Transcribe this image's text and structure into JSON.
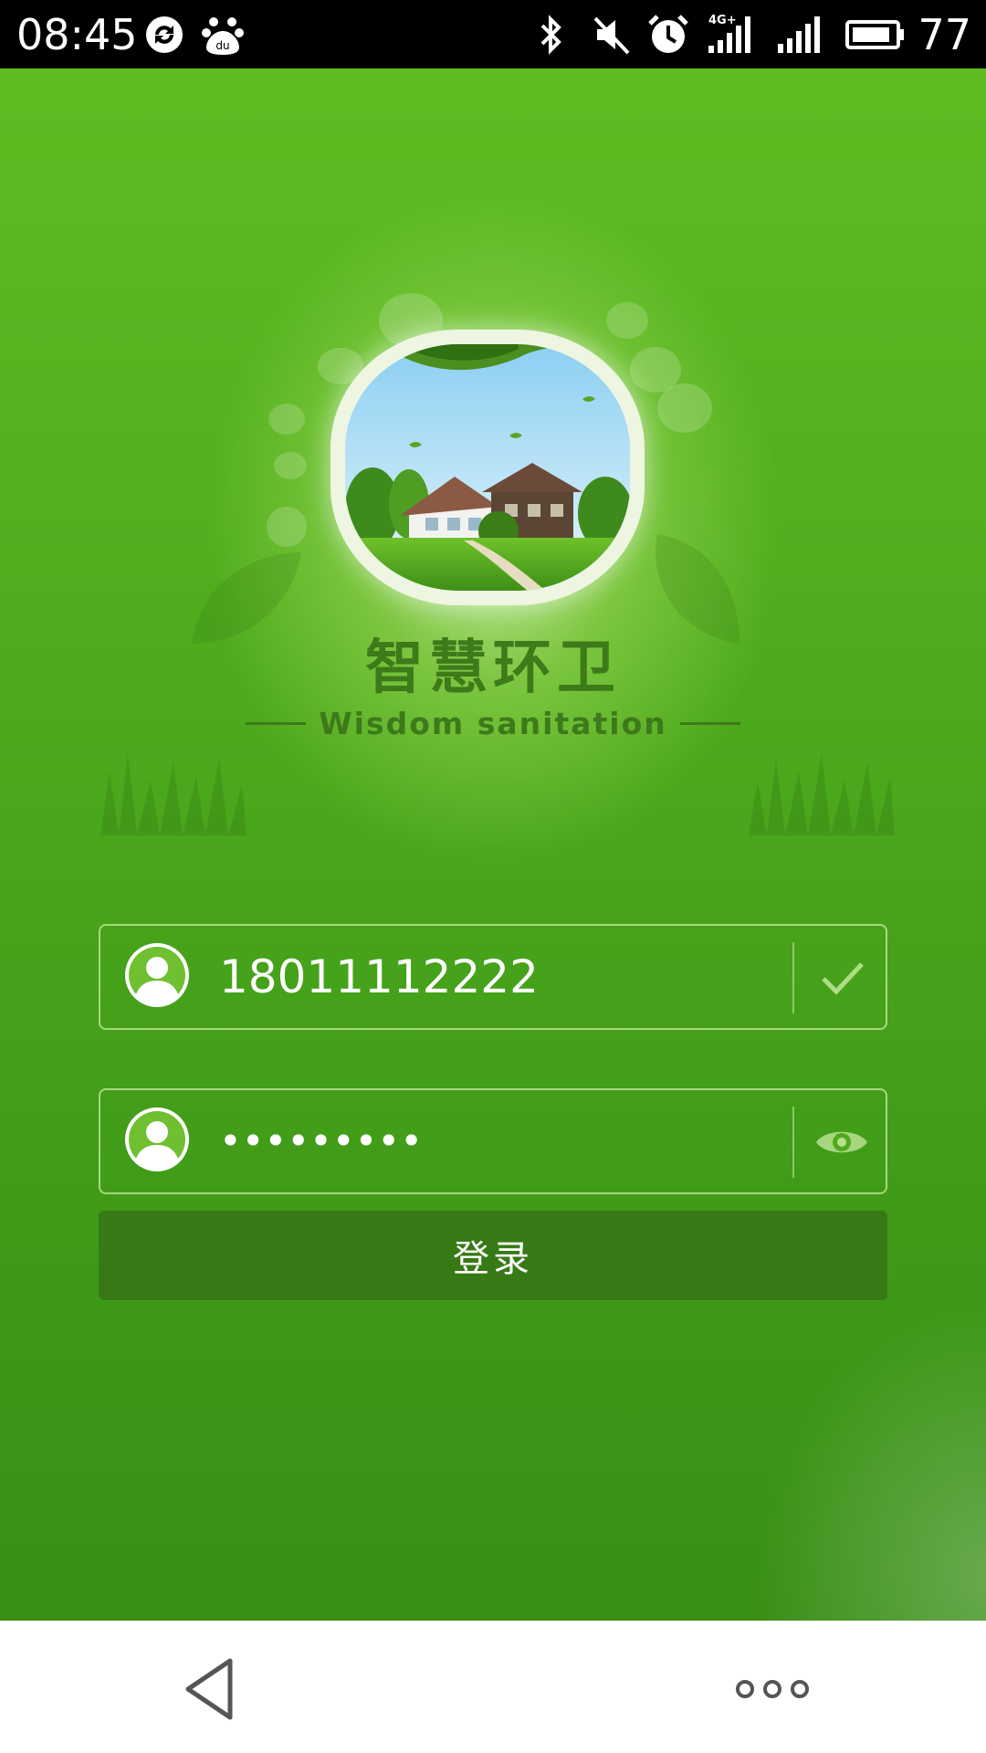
{
  "status_bar": {
    "time": "08:45",
    "battery_level": "77",
    "icons": [
      "sync-icon",
      "baidu-paw-icon",
      "bluetooth-icon",
      "mute-icon",
      "alarm-icon",
      "signal-4g-icon",
      "signal-icon",
      "battery-icon"
    ]
  },
  "brand": {
    "title_cn": "智慧环卫",
    "title_en": "Wisdom sanitation"
  },
  "login": {
    "username_value": "18011112222",
    "password_masked": "•••••••••",
    "username_status_icon": "check-icon",
    "password_toggle_icon": "eye-icon",
    "submit_label": "登录"
  },
  "nav": {
    "back_icon": "back-triangle-icon",
    "more_icon": "more-dots-icon"
  },
  "colors": {
    "primary_green": "#4eaa1c",
    "button_dark_green": "#377a15",
    "brand_text": "#3d7a1a"
  }
}
